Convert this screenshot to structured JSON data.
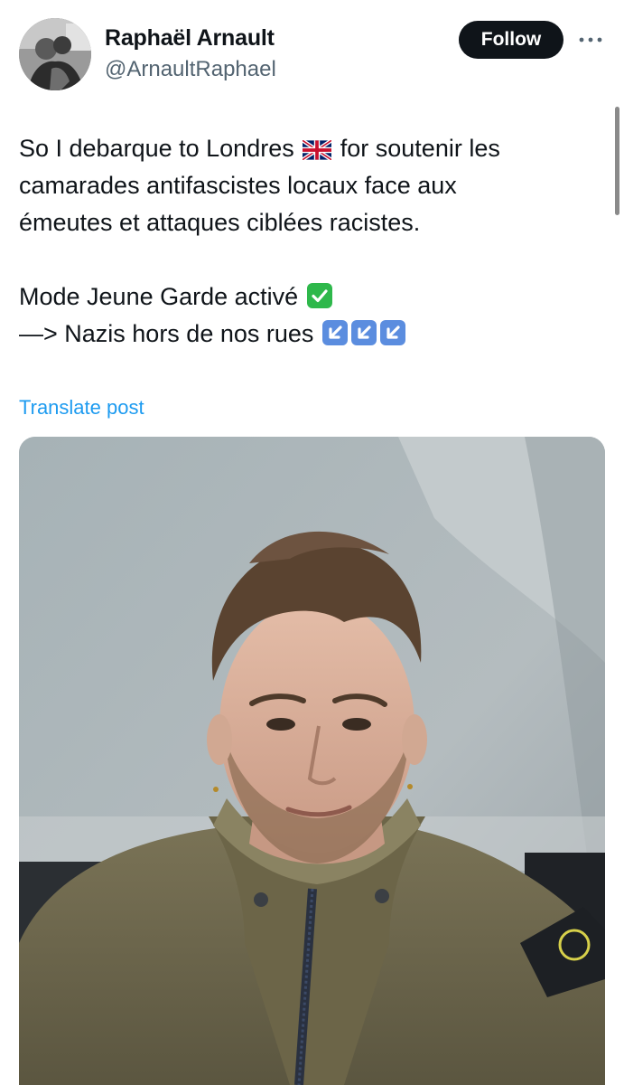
{
  "author": {
    "display_name": "Raphaël Arnault",
    "handle": "@ArnaultRaphael",
    "avatar_icon": "profile-photo"
  },
  "actions": {
    "follow_label": "Follow",
    "more_icon": "more-horizontal-icon"
  },
  "post": {
    "lines": [
      "So I debarque to Londres",
      "for soutenir les",
      "camarades antifascistes locaux face aux",
      "émeutes et attaques ciblées racistes.",
      "Mode Jeune Garde activé",
      "—> Nazis hors de nos rues"
    ],
    "emojis": [
      "uk-flag",
      "check-mark-button",
      "down-left-arrow",
      "down-left-arrow",
      "down-left-arrow"
    ],
    "translate_label": "Translate post"
  },
  "media": {
    "type": "photo",
    "subject": "selfie-photo"
  },
  "colors": {
    "text": "#0f1419",
    "secondary": "#536471",
    "link": "#1d9bf0",
    "follow_bg": "#0f1419",
    "check_green": "#2eb84b",
    "arrow_blue": "#5b8ddf"
  }
}
